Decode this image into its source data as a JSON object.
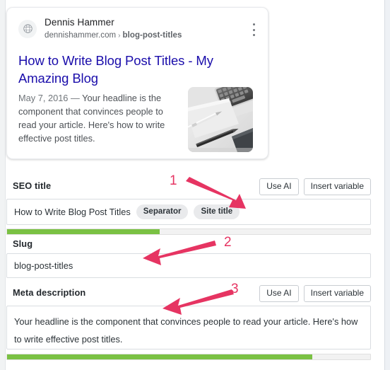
{
  "theme": {
    "accent_green": "#7ac143",
    "annotation_red": "#e63462",
    "link_blue": "#1a0dab",
    "page_bg": "#ffffff"
  },
  "preview_card": {
    "favicon_icon": "globe-icon",
    "site_name": "Dennis Hammer",
    "url_domain": "dennishammer.com",
    "url_separator": "›",
    "url_path": "blog-post-titles",
    "menu_icon": "kebab-menu-icon",
    "title": "How to Write Blog Post Titles - My Amazing Blog",
    "date": "May 7, 2016",
    "dash": "—",
    "snippet": "Your headline is the component that convinces people to read your article. Here's how to write effective post titles.",
    "thumbnail_alt": "desk-photo-thumbnail"
  },
  "fields": {
    "seo_title": {
      "label": "SEO title",
      "use_ai_label": "Use AI",
      "insert_variable_label": "Insert variable",
      "value_text": "How to Write Blog Post Titles",
      "chips": [
        "Separator",
        "Site title"
      ],
      "progress_percent": 42
    },
    "slug": {
      "label": "Slug",
      "value_text": "blog-post-titles"
    },
    "meta_description": {
      "label": "Meta description",
      "use_ai_label": "Use AI",
      "insert_variable_label": "Insert variable",
      "value_text": "Your headline is the component that convinces people to read your article. Here's how to write effective post titles.",
      "progress_percent": 84
    }
  },
  "annotations": [
    {
      "number": "1",
      "points_to": "seo-title-input"
    },
    {
      "number": "2",
      "points_to": "slug-input"
    },
    {
      "number": "3",
      "points_to": "meta-description-input"
    }
  ]
}
